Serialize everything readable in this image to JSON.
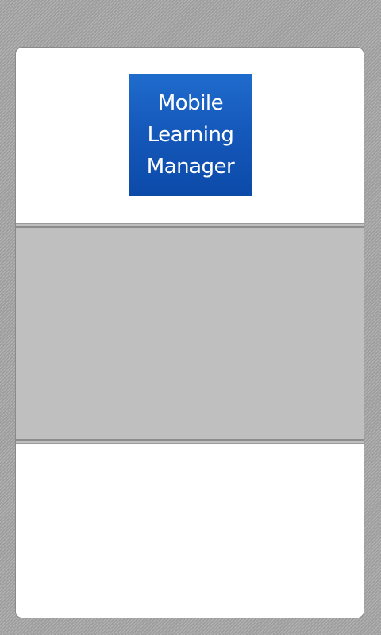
{
  "app": {
    "logo": {
      "lines": [
        "Mobile",
        "Learning",
        "Manager"
      ],
      "colors": {
        "top": "#1f6ccd",
        "bottom": "#0c4aa8",
        "text": "#ffffff"
      }
    }
  },
  "theme": {
    "background": "#a9a9a9",
    "card": "#ffffff",
    "panel": "#bfbfbf"
  }
}
